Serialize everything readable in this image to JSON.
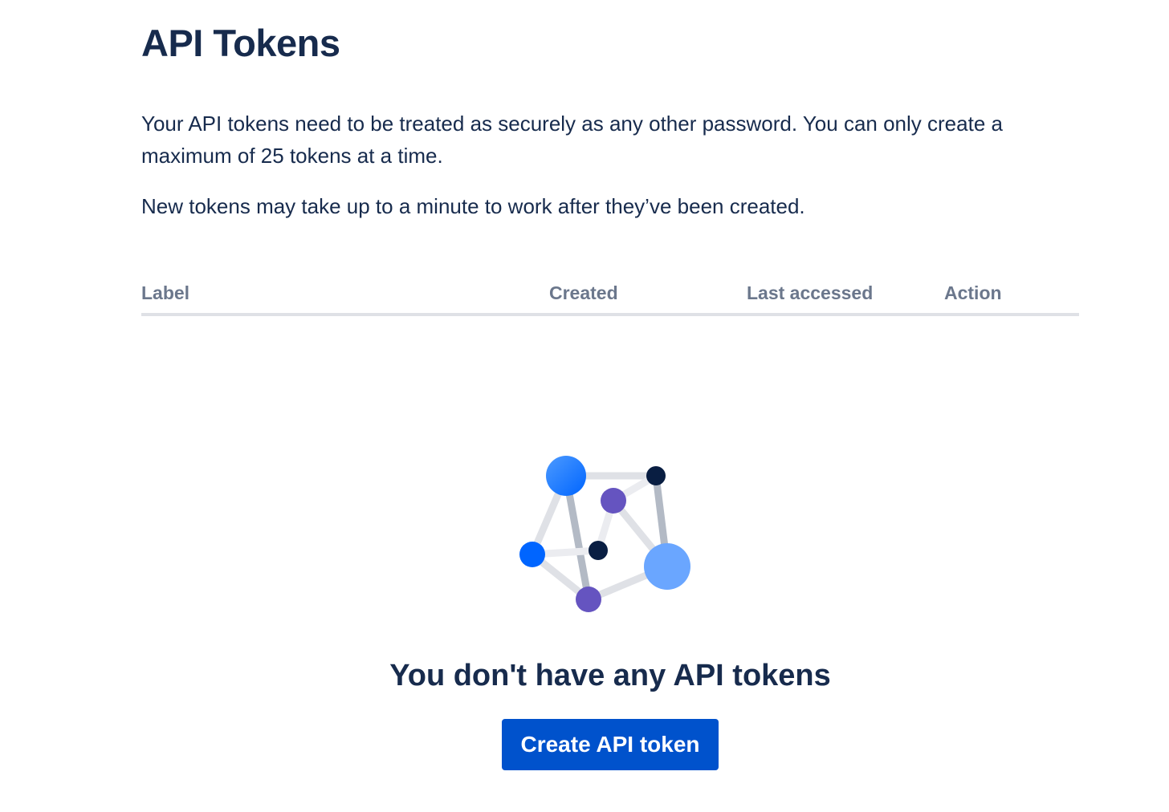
{
  "page": {
    "title": "API Tokens",
    "intro": "Your API tokens need to be treated as securely as any other password. You can only create a maximum of 25 tokens at a time.",
    "note": "New tokens may take up to a minute to work after they’ve been created."
  },
  "table": {
    "columns": [
      "Label",
      "Created",
      "Last accessed",
      "Action"
    ],
    "rows": []
  },
  "empty_state": {
    "illustration": "network-graph-illustration",
    "title": "You don't have any API tokens",
    "button_label": "Create API token"
  },
  "colors": {
    "text_primary": "#172B4D",
    "text_subtle": "#6B778C",
    "divider": "#DFE1E6",
    "button_primary": "#0052CC",
    "node_blue": "#2684FF",
    "node_light_blue": "#6AA6FF",
    "node_purple": "#6554C0",
    "node_navy": "#091E42"
  }
}
